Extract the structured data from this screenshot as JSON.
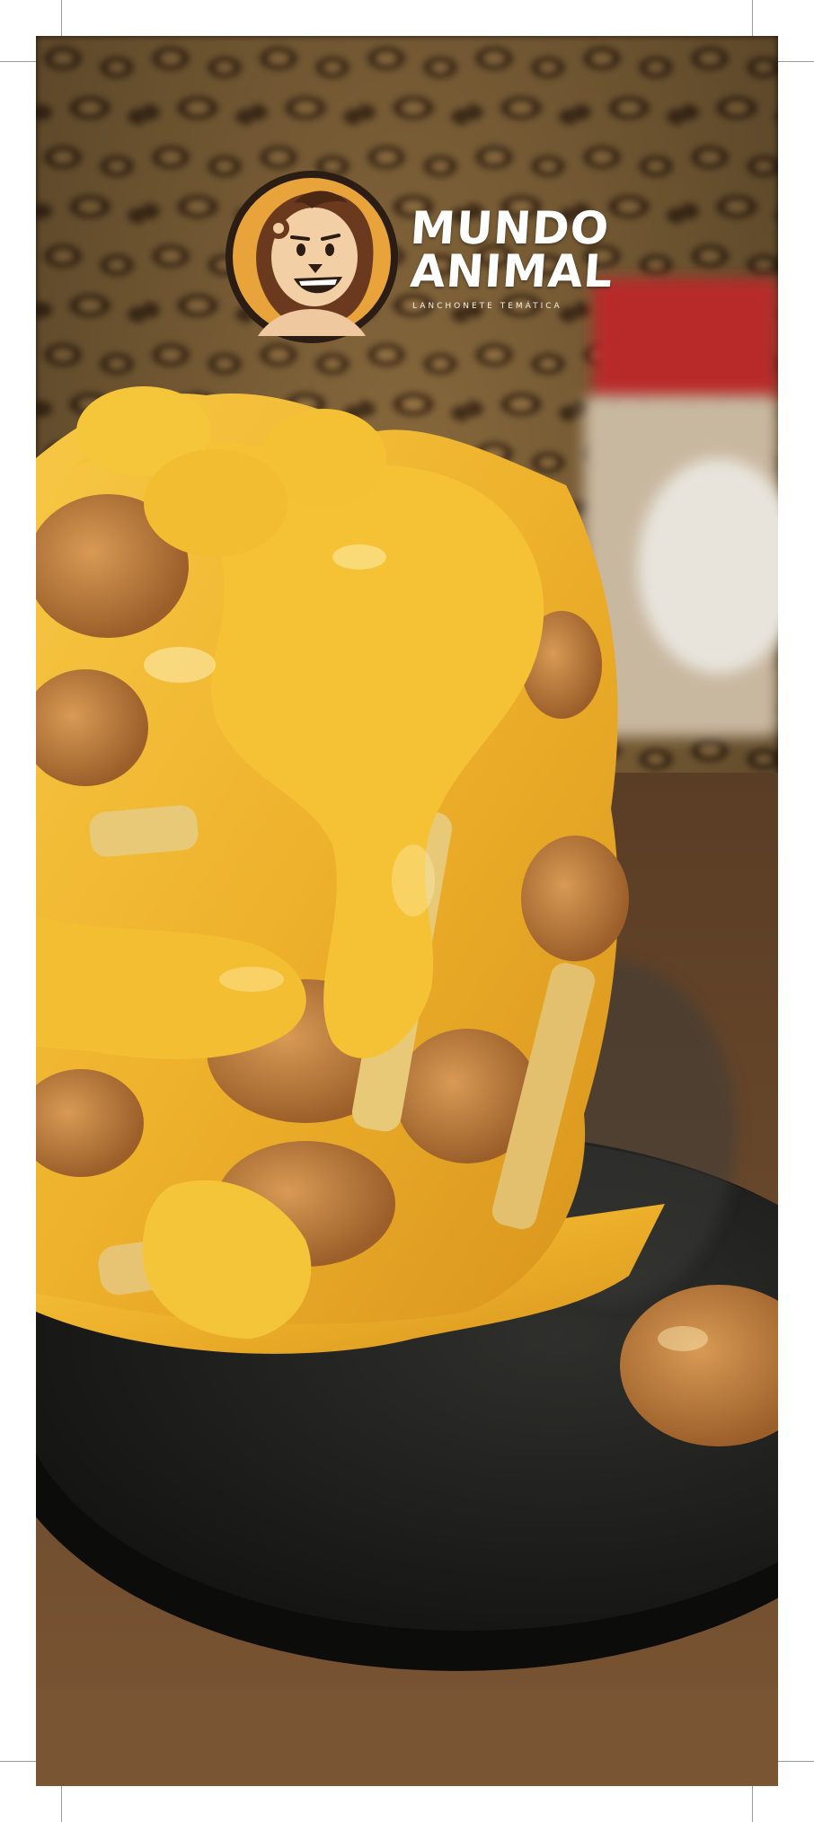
{
  "brand": {
    "line1": "MUNDO",
    "line2": "ANIMAL",
    "subtitle": "LANCHONETE TEMÁTICA",
    "mascot_icon": "lion-mascot-icon"
  },
  "colors": {
    "background": "#ffffff",
    "badge_orange": "#e8a43a",
    "badge_outline": "#2b1d14",
    "cheese": "#f2b52a",
    "skillet": "#1d1d1b",
    "wood": "#6b4a2e",
    "wall_leopard": "#8a6a3e"
  }
}
